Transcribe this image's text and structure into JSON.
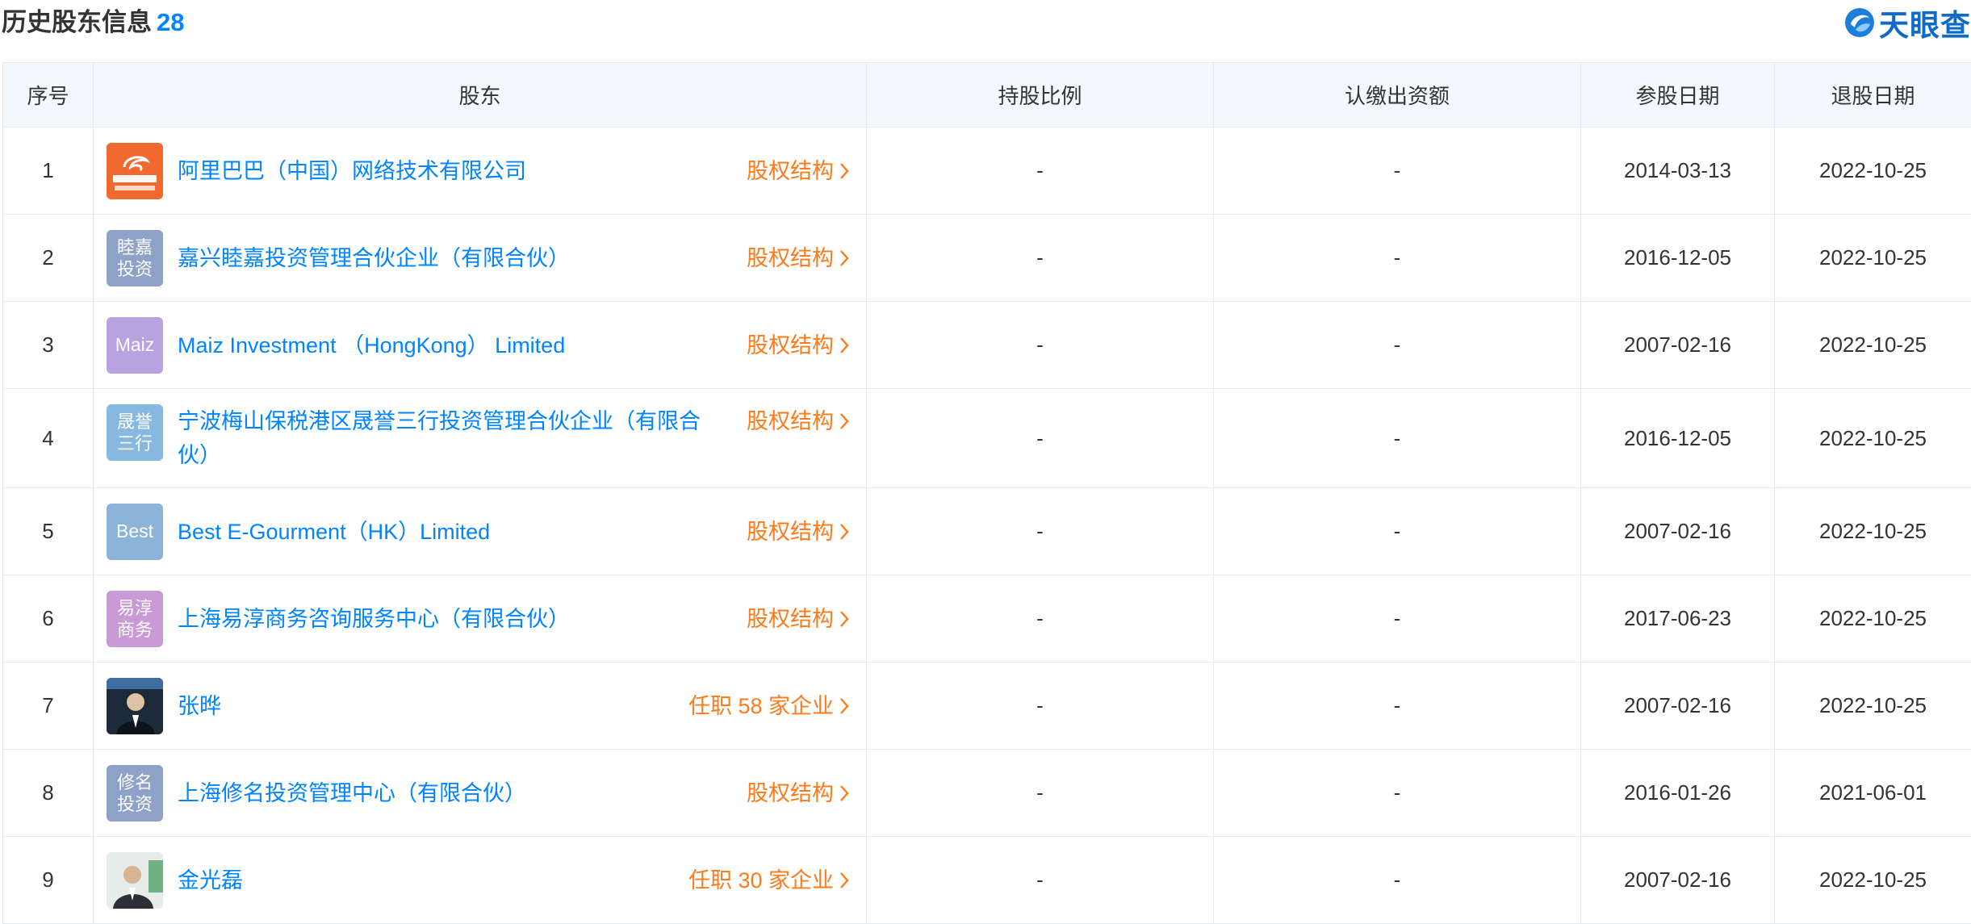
{
  "header": {
    "title": "历史股东信息",
    "count": "28",
    "brand": "天眼查"
  },
  "table": {
    "columns": [
      "序号",
      "股东",
      "持股比例",
      "认缴出资额",
      "参股日期",
      "退股日期"
    ],
    "rows": [
      {
        "index": "1",
        "logo_line1": "",
        "logo_line2": "",
        "logo_color": "#f06a2f",
        "logo_type": "alibaba",
        "name": "阿里巴巴（中国）网络技术有限公司",
        "action": "股权结构",
        "ratio": "-",
        "capital": "-",
        "start": "2014-03-13",
        "end": "2022-10-25"
      },
      {
        "index": "2",
        "logo_line1": "睦嘉",
        "logo_line2": "投资",
        "logo_color": "#8ea2c8",
        "logo_type": "text",
        "name": "嘉兴睦嘉投资管理合伙企业（有限合伙）",
        "action": "股权结构",
        "ratio": "-",
        "capital": "-",
        "start": "2016-12-05",
        "end": "2022-10-25"
      },
      {
        "index": "3",
        "logo_line1": "Maiz",
        "logo_line2": "",
        "logo_color": "#b9a2e0",
        "logo_type": "text",
        "name": "Maiz Investment （HongKong） Limited",
        "action": "股权结构",
        "ratio": "-",
        "capital": "-",
        "start": "2007-02-16",
        "end": "2022-10-25"
      },
      {
        "index": "4",
        "logo_line1": "晟誉",
        "logo_line2": "三行",
        "logo_color": "#86b8e0",
        "logo_type": "text",
        "name": "宁波梅山保税港区晟誉三行投资管理合伙企业（有限合伙）",
        "action": "股权结构",
        "ratio": "-",
        "capital": "-",
        "start": "2016-12-05",
        "end": "2022-10-25"
      },
      {
        "index": "5",
        "logo_line1": "Best",
        "logo_line2": "",
        "logo_color": "#8bb4d8",
        "logo_type": "text",
        "name": "Best E-Gourment（HK）Limited",
        "action": "股权结构",
        "ratio": "-",
        "capital": "-",
        "start": "2007-02-16",
        "end": "2022-10-25"
      },
      {
        "index": "6",
        "logo_line1": "易淳",
        "logo_line2": "商务",
        "logo_color": "#c99ad6",
        "logo_type": "text",
        "name": "上海易淳商务咨询服务中心（有限合伙）",
        "action": "股权结构",
        "ratio": "-",
        "capital": "-",
        "start": "2017-06-23",
        "end": "2022-10-25"
      },
      {
        "index": "7",
        "logo_line1": "",
        "logo_line2": "",
        "logo_color": "#2a3a4a",
        "logo_type": "photo-dark",
        "name": "张晔",
        "action": "任职 58 家企业",
        "ratio": "-",
        "capital": "-",
        "start": "2007-02-16",
        "end": "2022-10-25"
      },
      {
        "index": "8",
        "logo_line1": "修名",
        "logo_line2": "投资",
        "logo_color": "#8ea2c8",
        "logo_type": "text",
        "name": "上海修名投资管理中心（有限合伙）",
        "action": "股权结构",
        "ratio": "-",
        "capital": "-",
        "start": "2016-01-26",
        "end": "2021-06-01"
      },
      {
        "index": "9",
        "logo_line1": "",
        "logo_line2": "",
        "logo_color": "#d8dde0",
        "logo_type": "photo-light",
        "name": "金光磊",
        "action": "任职 30 家企业",
        "ratio": "-",
        "capital": "-",
        "start": "2007-02-16",
        "end": "2022-10-25"
      }
    ]
  }
}
